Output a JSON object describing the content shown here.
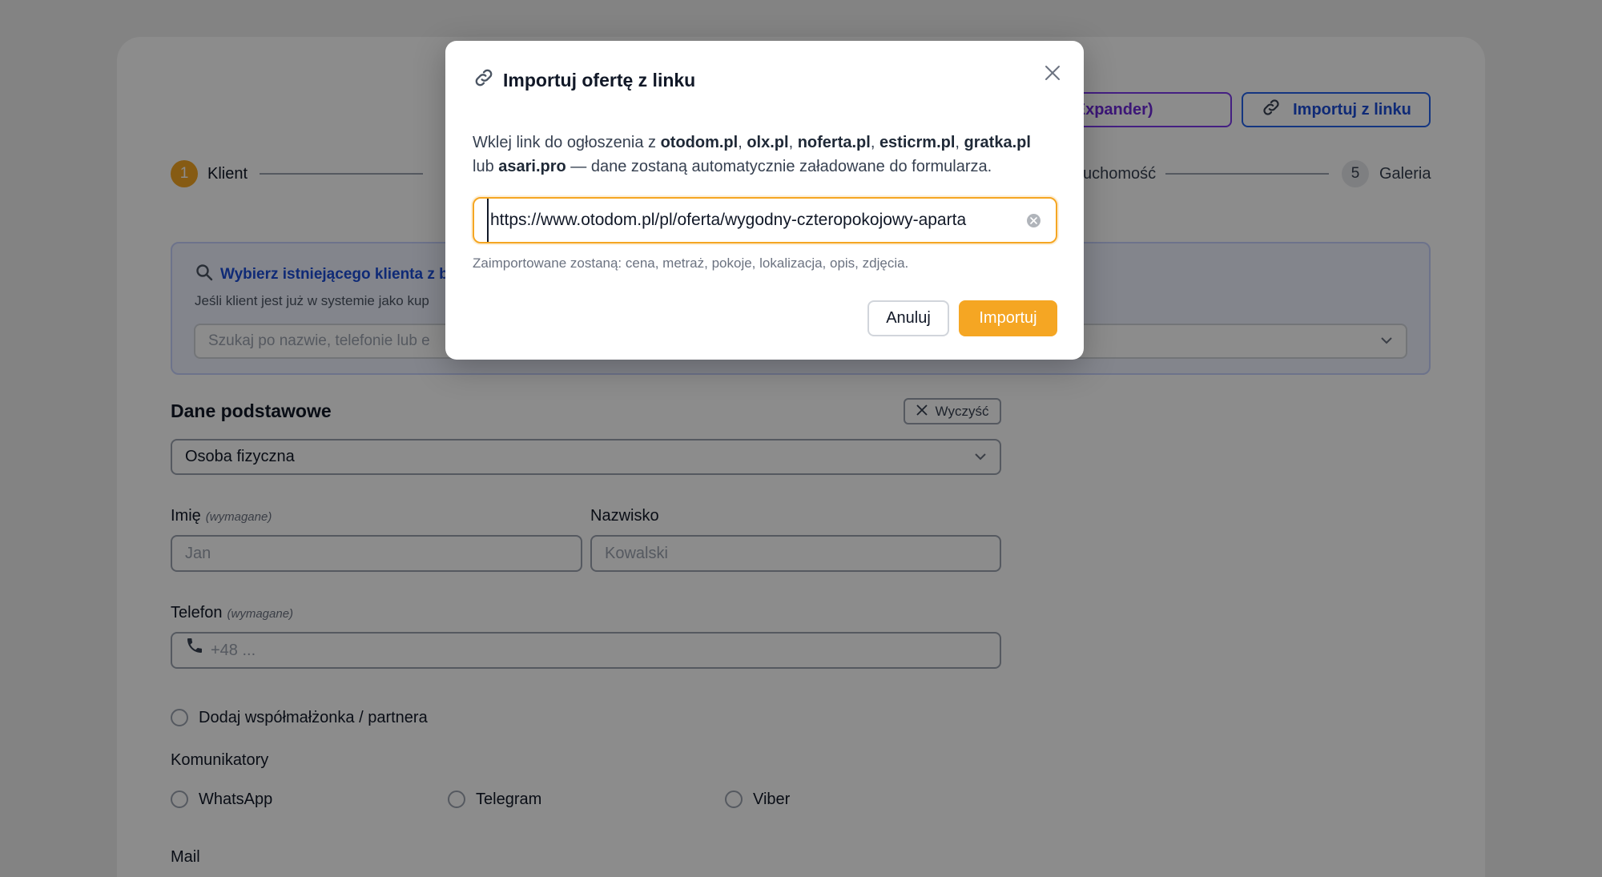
{
  "top_actions": {
    "pdf_button": "j PDF (Expander)",
    "link_button": "Importuj z linku"
  },
  "stepper": {
    "step1": {
      "number": "1",
      "label": "Klient"
    },
    "step4": {
      "label": "uchomość"
    },
    "step5": {
      "number": "5",
      "label": "Galeria"
    }
  },
  "client_search": {
    "title": "Wybierz istniejącego klienta z b",
    "subtitle": "Jeśli klient jest już w systemie jako kup",
    "placeholder": "Szukaj po nazwie, telefonie lub e"
  },
  "basic_data": {
    "title": "Dane podstawowe",
    "clear_button": "Wyczyść",
    "person_type": "Osoba fizyczna",
    "first_name_label": "Imię",
    "required_hint": "(wymagane)",
    "first_name_placeholder": "Jan",
    "last_name_label": "Nazwisko",
    "last_name_placeholder": "Kowalski",
    "phone_label": "Telefon",
    "phone_placeholder": "+48 ...",
    "spouse_label": "Dodaj współmałżonka / partnera",
    "messengers_label": "Komunikatory",
    "messengers": [
      "WhatsApp",
      "Telegram",
      "Viber"
    ],
    "mail_label": "Mail"
  },
  "modal": {
    "title": "Importuj ofertę z linku",
    "desc_prefix": "Wklej link do ogłoszenia z ",
    "sites": [
      "otodom.pl",
      "olx.pl",
      "noferta.pl",
      "esticrm.pl",
      "gratka.pl"
    ],
    "desc_or": "lub",
    "site_last": "asari.pro",
    "desc_suffix": " — dane zostaną automatycznie załadowane do formularza.",
    "url_value": "https://www.otodom.pl/pl/oferta/wygodny-czteropokojowy-aparta",
    "hint": "Zaimportowane zostaną: cena, metraż, pokoje, lokalizacja, opis, zdjęcia.",
    "cancel_label": "Anuluj",
    "import_label": "Importuj"
  },
  "colors": {
    "accent_orange": "#f5a623",
    "link_blue": "#1d4ed8",
    "pdf_purple": "#6d28d9"
  }
}
